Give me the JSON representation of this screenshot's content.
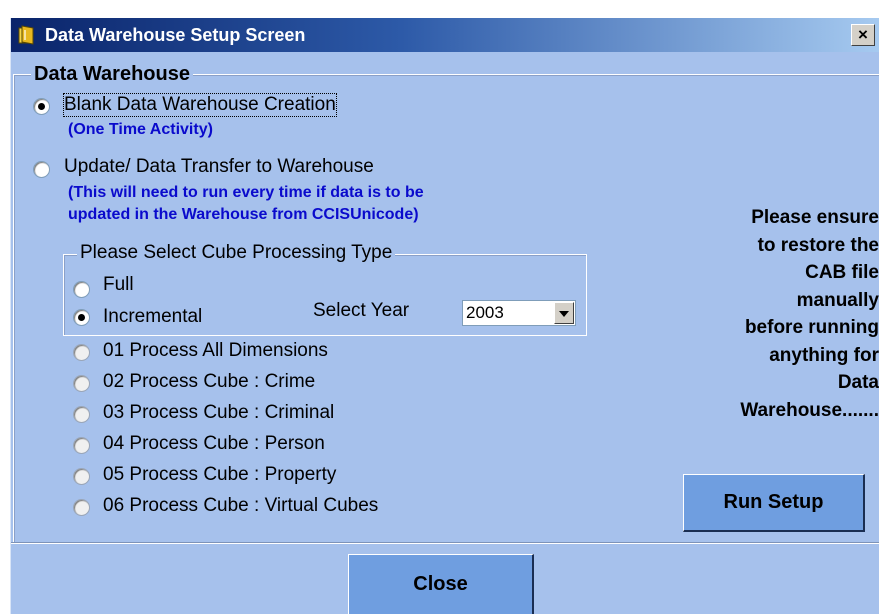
{
  "window": {
    "title": "Data Warehouse Setup Screen",
    "close_glyph": "×",
    "icon": "folder-icon"
  },
  "frame": {
    "label": "Data Warehouse"
  },
  "options": {
    "blank": {
      "label": "Blank Data Warehouse Creation",
      "note": "(One Time Activity)",
      "selected": true
    },
    "update": {
      "label": "Update/ Data Transfer to Warehouse",
      "note_line1": "(This will need to run every time if data is to be",
      "note_line2": "updated in the Warehouse from CCISUnicode)",
      "selected": false
    }
  },
  "cube_type": {
    "label": "Please Select Cube Processing Type",
    "full": "Full",
    "incremental": "Incremental",
    "selected": "Incremental",
    "year_label": "Select Year",
    "year_value": "2003"
  },
  "process_options": [
    "01 Process All Dimensions",
    "02 Process Cube : Crime",
    "03 Process Cube : Criminal",
    "04 Process Cube : Person",
    "05 Process Cube : Property",
    "06 Process Cube : Virtual Cubes"
  ],
  "notice": {
    "line1": "Please ensure",
    "line2": "to restore the",
    "line3": "CAB file",
    "line4": "manually",
    "line5": "before running",
    "line6": "anything for",
    "line7": "Data",
    "line8": "Warehouse......."
  },
  "buttons": {
    "run_setup": "Run Setup",
    "close": "Close"
  },
  "colors": {
    "background": "#a6c1ec",
    "titlebar": "#0a246a",
    "note_blue": "#0a0acc",
    "button": "#6f9ee0"
  }
}
